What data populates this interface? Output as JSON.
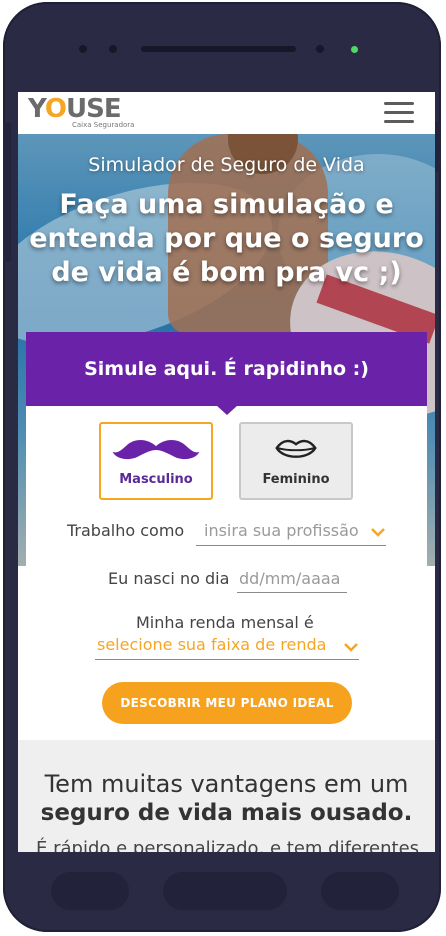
{
  "header": {
    "logo_word_a": "Y",
    "logo_word_o": "O",
    "logo_word_b": "USE",
    "logo_subtitle": "Caixa Seguradora",
    "menu_icon": "hamburger-menu-icon"
  },
  "hero": {
    "subtitle": "Simulador de Seguro de Vida",
    "title_line1": "Faça uma simulação e",
    "title_line2": "entenda por que o seguro",
    "title_line3": "de vida é bom pra vc ;)"
  },
  "form": {
    "header": "Simule aqui. É rapidinho :)",
    "gender_male": "Masculino",
    "gender_female": "Feminino",
    "gender_male_icon": "mustache-icon",
    "gender_female_icon": "lips-icon",
    "job_label": "Trabalho como",
    "job_placeholder": "insira sua profissão",
    "birth_label": "Eu nasci no dia",
    "birth_placeholder": "dd/mm/aaaa",
    "income_label": "Minha renda mensal é",
    "income_placeholder": "selecione sua faixa de renda",
    "submit": "DESCOBRIR MEU PLANO IDEAL"
  },
  "benefits": {
    "line1": "Tem muitas vantagens em um",
    "line2": "seguro de vida mais ousado.",
    "line3": "É rápido e personalizado, e tem diferentes"
  },
  "colors": {
    "brand_purple": "#6a23a8",
    "brand_orange": "#f7a21e",
    "phone_frame": "#2a2a44"
  }
}
